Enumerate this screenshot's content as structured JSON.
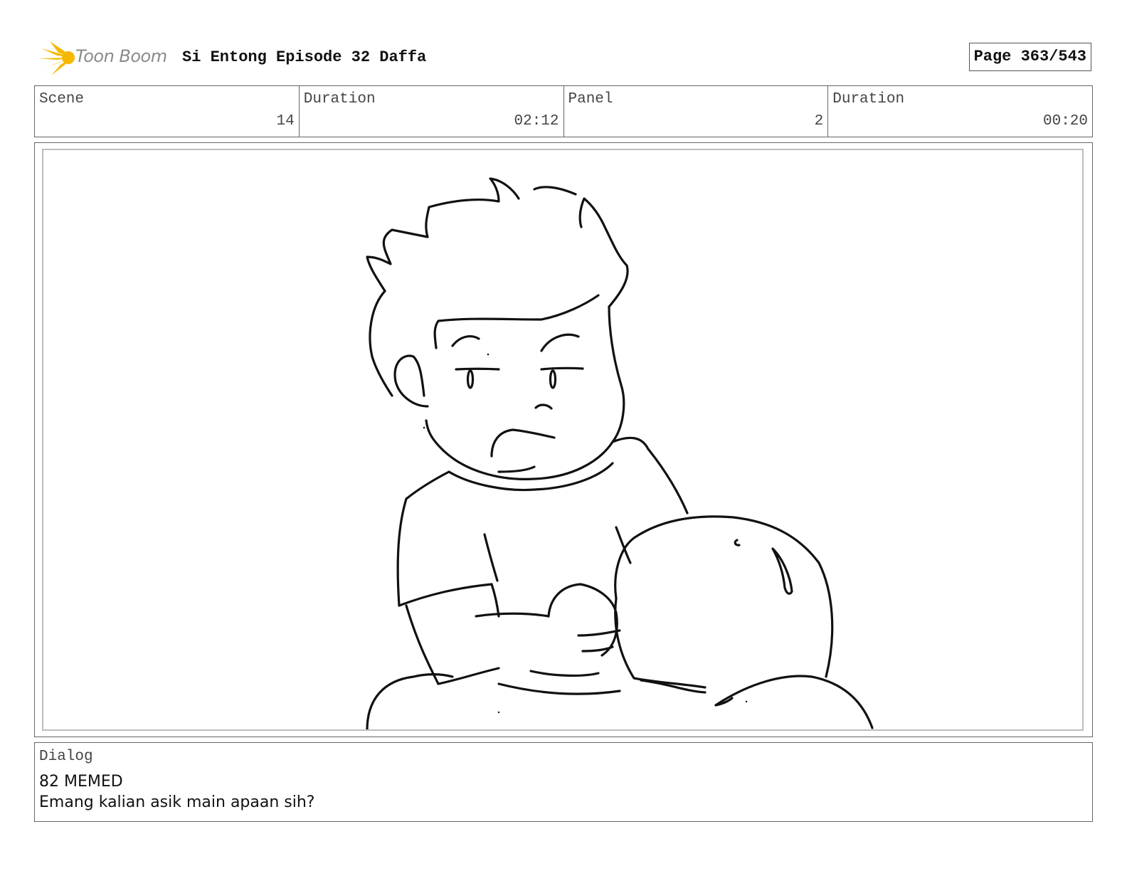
{
  "header": {
    "logo_text": "Toon Boom",
    "title": "Si Entong Episode 32 Daffa",
    "page": "Page 363/543"
  },
  "info": {
    "scene_label": "Scene",
    "scene_value": "14",
    "scene_duration_label": "Duration",
    "scene_duration_value": "02:12",
    "panel_label": "Panel",
    "panel_value": "2",
    "panel_duration_label": "Duration",
    "panel_duration_value": "00:20"
  },
  "dialog": {
    "label": "Dialog",
    "line1": "82 MEMED",
    "line2": "Emang kalian asik main apaan sih?"
  },
  "colors": {
    "logo_yellow": "#f5b800",
    "ink": "#111111"
  }
}
